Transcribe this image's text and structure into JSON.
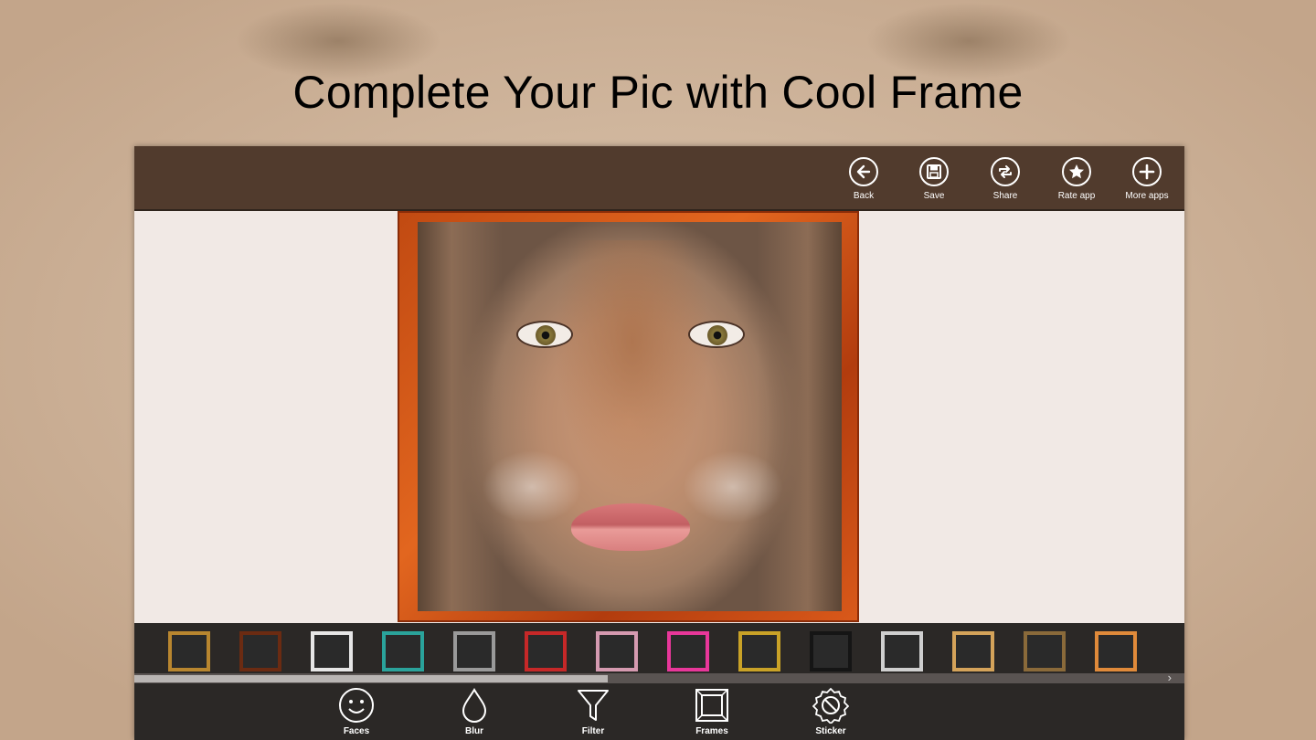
{
  "headline": "Complete Your Pic with Cool Frame",
  "topbar": {
    "back_label": "Back",
    "save_label": "Save",
    "share_label": "Share",
    "rate_label": "Rate app",
    "more_label": "More apps"
  },
  "frames_strip": {
    "items": [
      {
        "name": "gold-frame",
        "color": "#b8862f"
      },
      {
        "name": "brown-frame",
        "color": "#6b2b12"
      },
      {
        "name": "white-frame",
        "color": "#e6e6e6"
      },
      {
        "name": "teal-frame",
        "color": "#2aa39b"
      },
      {
        "name": "silver-frame",
        "color": "#9a9a9a"
      },
      {
        "name": "red-frame",
        "color": "#c62828"
      },
      {
        "name": "pink-outline-frame",
        "color": "#d59ab0"
      },
      {
        "name": "pink-frame",
        "color": "#e8379a"
      },
      {
        "name": "multicolor-frame",
        "color": "#c9a227"
      },
      {
        "name": "black-frame",
        "color": "#151515"
      },
      {
        "name": "dotted-frame",
        "color": "#cfcfcf"
      },
      {
        "name": "film-frame",
        "color": "#d4a35a"
      },
      {
        "name": "bronze-frame",
        "color": "#8a6a3a"
      },
      {
        "name": "orange-frame",
        "color": "#e08a3a"
      }
    ]
  },
  "bottombar": {
    "faces_label": "Faces",
    "blur_label": "Blur",
    "filter_label": "Filter",
    "frames_label": "Frames",
    "sticker_label": "Sticker"
  }
}
